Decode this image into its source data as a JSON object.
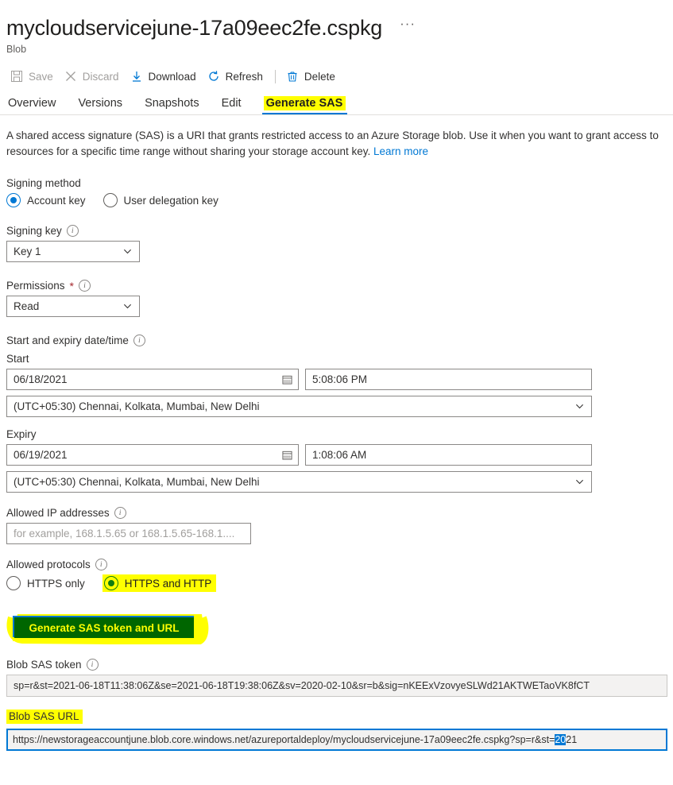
{
  "header": {
    "title": "mycloudservicejune-17a09eec2fe.cspkg",
    "subtitle": "Blob",
    "more_label": "···"
  },
  "commandbar": {
    "items": [
      {
        "label": "Save",
        "icon": "save-icon",
        "disabled": true
      },
      {
        "label": "Discard",
        "icon": "discard-icon",
        "disabled": true
      },
      {
        "label": "Download",
        "icon": "download-icon",
        "disabled": false
      },
      {
        "label": "Refresh",
        "icon": "refresh-icon",
        "disabled": false
      },
      {
        "label": "Delete",
        "icon": "delete-icon",
        "disabled": false
      }
    ]
  },
  "tabs": [
    {
      "label": "Overview",
      "active": false
    },
    {
      "label": "Versions",
      "active": false
    },
    {
      "label": "Snapshots",
      "active": false
    },
    {
      "label": "Edit",
      "active": false
    },
    {
      "label": "Generate SAS",
      "active": true,
      "highlighted": true
    }
  ],
  "description": {
    "text_before_link": "A shared access signature (SAS) is a URI that grants restricted access to an Azure Storage blob. Use it when you want to grant access to resources for a specific time range without sharing your storage account key. ",
    "link_label": "Learn more"
  },
  "signing_method": {
    "label": "Signing method",
    "options": [
      {
        "label": "Account key",
        "selected": true
      },
      {
        "label": "User delegation key",
        "selected": false
      }
    ]
  },
  "signing_key": {
    "label": "Signing key",
    "value": "Key 1",
    "info_icon": "info-icon",
    "chevron_icon": "chevron-down-icon"
  },
  "permissions": {
    "label": "Permissions",
    "required_marker": "*",
    "value": "Read",
    "info_icon": "info-icon",
    "chevron_icon": "chevron-down-icon"
  },
  "datetime": {
    "section_label": "Start and expiry date/time",
    "start": {
      "label": "Start",
      "date": "06/18/2021",
      "time": "5:08:06 PM",
      "timezone": "(UTC+05:30) Chennai, Kolkata, Mumbai, New Delhi",
      "calendar_icon": "calendar-icon"
    },
    "expiry": {
      "label": "Expiry",
      "date": "06/19/2021",
      "time": "1:08:06 AM",
      "timezone": "(UTC+05:30) Chennai, Kolkata, Mumbai, New Delhi",
      "calendar_icon": "calendar-icon"
    }
  },
  "allowed_ip": {
    "label": "Allowed IP addresses",
    "value": "",
    "placeholder": "for example, 168.1.5.65 or 168.1.5.65-168.1...."
  },
  "allowed_protocols": {
    "label": "Allowed protocols",
    "options": [
      {
        "label": "HTTPS only",
        "selected": false,
        "highlighted": false
      },
      {
        "label": "HTTPS and HTTP",
        "selected": true,
        "highlighted": true
      }
    ]
  },
  "generate_button": {
    "label": "Generate SAS token and URL",
    "annotation_fill": "#006600",
    "annotation_text_color": "#ffff00",
    "underlying_button_color": "#0078d4",
    "highlighter_color": "#ffff00"
  },
  "sas_token": {
    "label": "Blob SAS token",
    "value": "sp=r&st=2021-06-18T11:38:06Z&se=2021-06-18T19:38:06Z&sv=2020-02-10&sr=b&sig=nKEExVzovyeSLWd21AKTWETaoVK8fCT"
  },
  "sas_url": {
    "label": "Blob SAS URL",
    "label_highlighted": true,
    "value_prefix": "https://newstorageaccountjune.blob.core.windows.net/azureportaldeploy/mycloudservicejune-17a09eec2fe.cspkg?sp=r&st=",
    "value_selected": "20",
    "value_suffix": "21",
    "focused": true
  },
  "colors": {
    "accent": "#0078d4",
    "highlight": "#ffff00",
    "annotation_green": "#006600",
    "required_red": "#a4262c",
    "readonly_bg": "#f3f2f1"
  }
}
